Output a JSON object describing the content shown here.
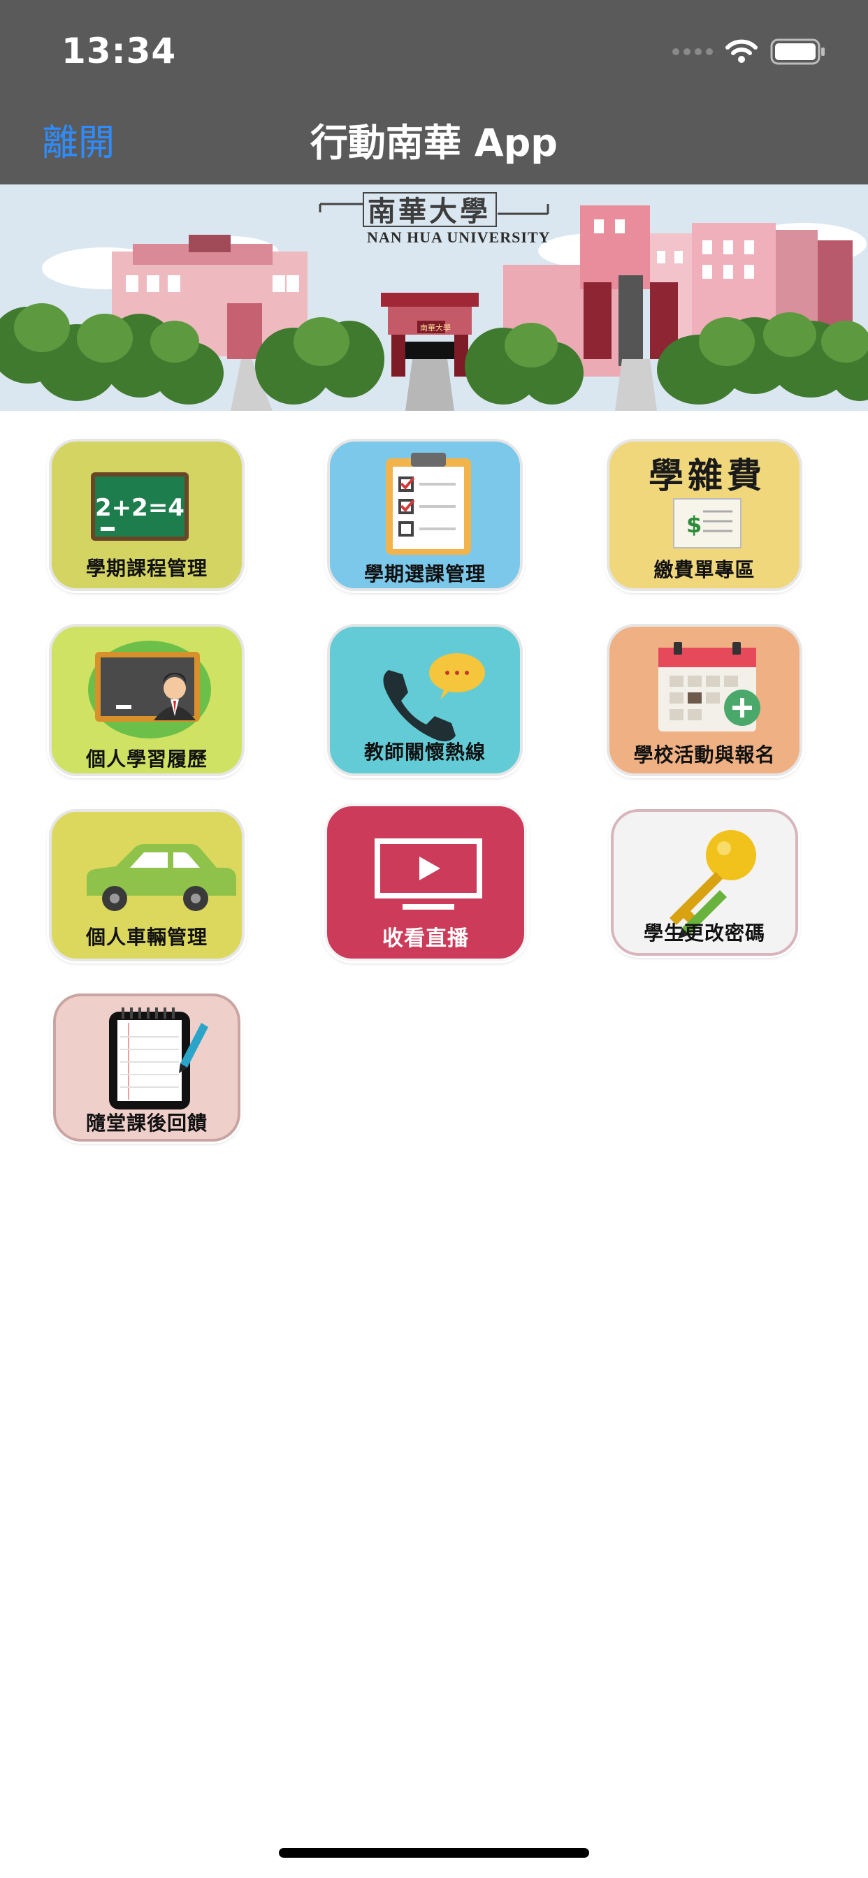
{
  "status_bar": {
    "time": "13:34"
  },
  "nav": {
    "back_label": "離開",
    "title": "行動南華 App"
  },
  "banner": {
    "name_cn": "南華大學",
    "name_en": "NAN HUA UNIVERSITY",
    "gate_sign": "南華大學"
  },
  "tiles": [
    {
      "label": "學期課程管理",
      "board_text": "2+2=4"
    },
    {
      "label": "學期選課管理"
    },
    {
      "label": "繳費單專區",
      "heading": "學雜費",
      "dollar": "$"
    },
    {
      "label": "個人學習履歷"
    },
    {
      "label": "教師關懷熱線"
    },
    {
      "label": "學校活動與報名"
    },
    {
      "label": "個人車輛管理"
    },
    {
      "label": "收看直播"
    },
    {
      "label": "學生更改密碼"
    },
    {
      "label": "隨堂課後回饋"
    }
  ],
  "colors": {
    "topbar": "#5a5a5a",
    "link_blue": "#2f8cff",
    "tile_green_yellow": "#d4d462",
    "tile_blue": "#7cc8ea",
    "tile_yellow": "#f0d77c",
    "tile_lime": "#cfe263",
    "tile_teal": "#63cbd6",
    "tile_orange": "#efb183",
    "tile_olive": "#dcd85d",
    "tile_red": "#cc3b5a",
    "tile_grey": "#f3f3f3",
    "tile_pink": "#efcfca"
  }
}
